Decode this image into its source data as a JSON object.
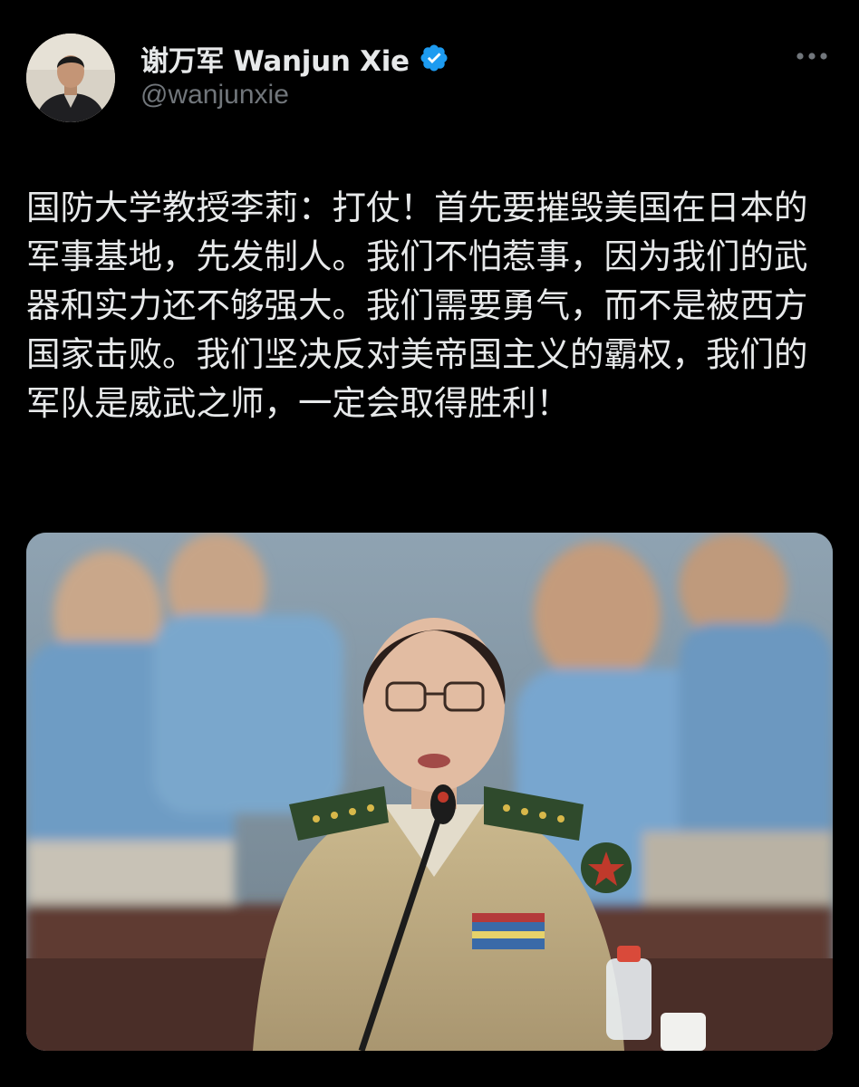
{
  "author": {
    "display_name": "谢万军 Wanjun Xie",
    "handle": "@wanjunxie",
    "verified": true,
    "avatar_icon": "person-avatar"
  },
  "tweet": {
    "text": "国防大学教授李莉：打仗！首先要摧毁美国在日本的军事基地，先发制人。我们不怕惹事，因为我们的武器和实力还不够强大。我们需要勇气，而不是被西方国家击败。我们坚决反对美帝国主义的霸权，我们的军队是威武之师，一定会取得胜利！"
  },
  "media": {
    "type": "photo",
    "subject": "woman in military uniform speaking at microphone"
  },
  "colors": {
    "background": "#000000",
    "text_primary": "#e7e9ea",
    "text_secondary": "#71767b",
    "verified_blue": "#1d9bf0"
  },
  "icons": {
    "more": "more-horizontal-icon",
    "verified": "verified-badge-icon"
  }
}
